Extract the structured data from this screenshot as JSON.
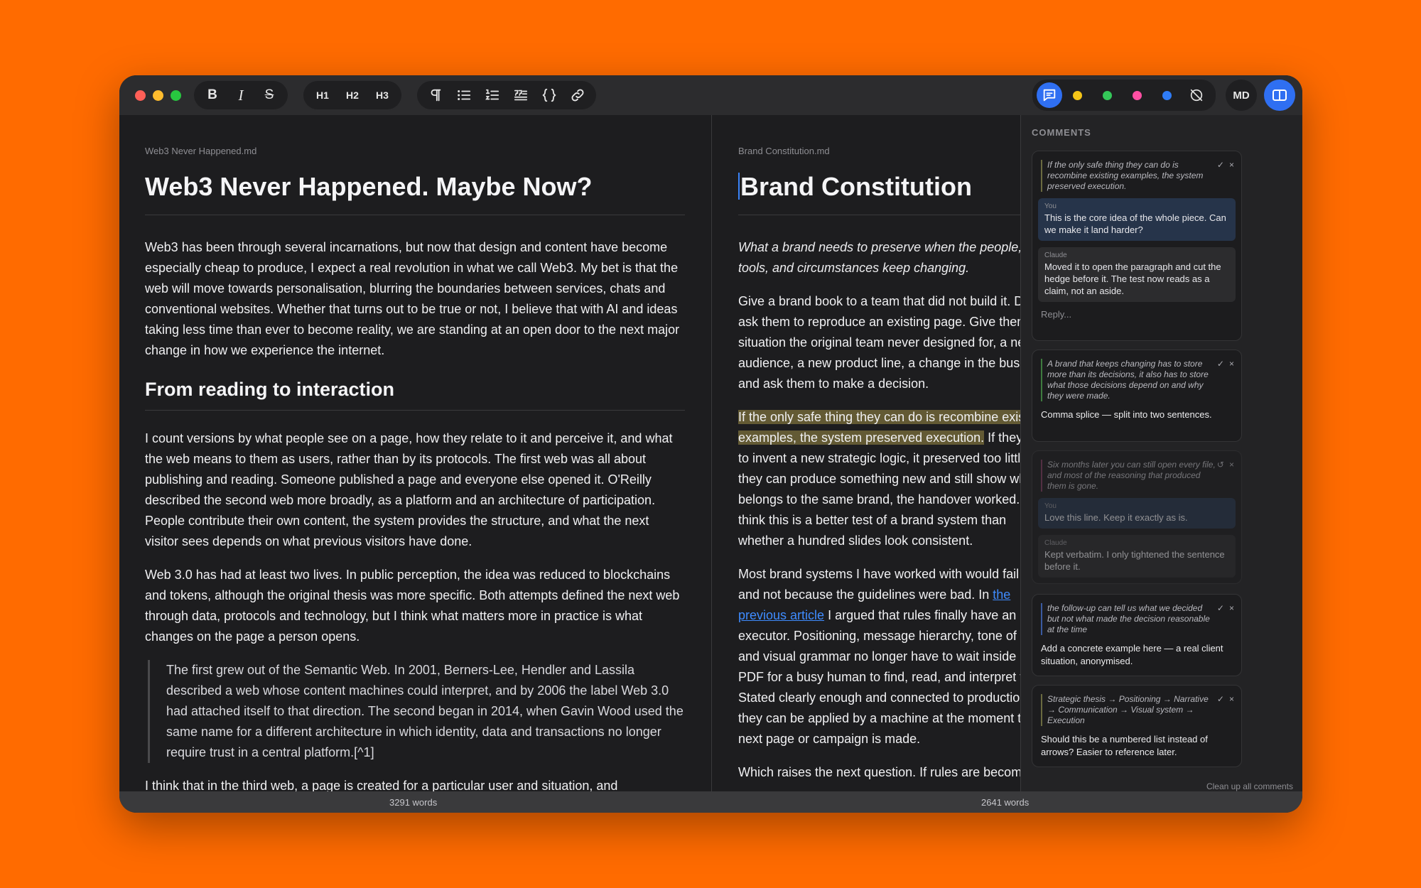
{
  "toolbar": {
    "format_buttons": {
      "bold": "B",
      "italic": "I",
      "strike": "S"
    },
    "headings": [
      "H1",
      "H2",
      "H3"
    ],
    "md_label": "MD"
  },
  "colors": {
    "yellow": "#f5c518",
    "green": "#34c759",
    "pink": "#ff4fa3",
    "blue": "#2f7cf6",
    "accent": "#2f6ff2"
  },
  "left_doc": {
    "filename": "Web3 Never Happened.md",
    "title": "Web3 Never Happened. Maybe Now?",
    "p1": "Web3 has been through several incarnations, but now that design and content have become especially cheap to produce, I expect a real revolution in what we call Web3. My bet is that the web will move towards personalisation, blurring the boundaries between services, chats and conventional websites. Whether that turns out to be true or not, I believe that with AI and ideas taking less time than ever to become reality, we are standing at an open door to the next major change in how we experience the internet.",
    "h2": "From reading to interaction",
    "p2": "I count versions by what people see on a page, how they relate to it and perceive it, and what the web means to them as users, rather than by its protocols. The first web was all about publishing and reading. Someone published a page and everyone else opened it. O'Reilly described the second web more broadly, as a platform and an architecture of participation. People contribute their own content, the system provides the structure, and what the next visitor sees depends on what previous visitors have done.",
    "p3": "Web 3.0 has had at least two lives. In public perception, the idea was reduced to blockchains and tokens, although the original thesis was more specific. Both attempts defined the next web through data, protocols and technology, but I think what matters more in practice is what changes on the page a person opens.",
    "quote": "The first grew out of the Semantic Web. In 2001, Berners-Lee, Hendler and Lassila described a web whose content machines could interpret, and by 2006 the label Web 3.0 had attached itself to that direction. The second began in 2014, when Gavin Wood used the same name for a different architecture in which identity, data and transactions no longer require trust in a central platform.[^1]",
    "p4": "I think that in the third web, a page is created for a particular user and situation, and",
    "word_count": "3291 words"
  },
  "right_doc": {
    "filename": "Brand Constitution.md",
    "title": "Brand Constitution",
    "lead": "What a brand needs to preserve when the people, tools, and circumstances keep changing.",
    "p1": "Give a brand book to a team that did not build it. Do not ask them to reproduce an existing page. Give them a situation the original team never designed for, a new audience, a new product line, a change in the business, and ask them to make a decision.",
    "p2_highlight": "If the only safe thing they can do is recombine existing examples, the system preserved execution.",
    "p2_rest": " If they have to invent a new strategic logic, it preserved too little. If they can produce something new and still show why it belongs to the same brand, the handover worked. I think this is a better test of a brand system than whether a hundred slides look consistent.",
    "p3_start": "Most brand systems I have worked with would fail it, and not because the guidelines were bad. In ",
    "p3_link": "the previous article",
    "p3_end": " I argued that rules finally have an executor. Positioning, message hierarchy, tone of voice, and visual grammar no longer have to wait inside a PDF for a busy human to find, read, and interpret them. Stated clearly enough and connected to production, they can be applied by a machine at the moment the next page or campaign is made.",
    "p4": "Which raises the next question. If rules are becoming",
    "word_count": "2641 words"
  },
  "comments": {
    "title": "COMMENTS",
    "cleanup": "Clean up all comments",
    "reply_placeholder": "Reply...",
    "items": [
      {
        "quote": "If the only safe thing they can do is recombine existing examples, the system preserved execution.",
        "you_label": "You",
        "you_text": "This is the core idea of the whole piece. Can we make it land harder?",
        "claude_label": "Claude",
        "claude_text": "Moved it to open the paragraph and cut the hedge before it. The test now reads as a claim, not an aside."
      },
      {
        "quote": "A brand that keeps changing has to store more than its decisions, it also has to store what those decisions depend on and why they were made.",
        "note": "Comma splice — split into two sentences."
      },
      {
        "quote": "Six months later you can still open every file, and most of the reasoning that produced them is gone.",
        "you_label": "You",
        "you_text": "Love this line. Keep it exactly as is.",
        "claude_label": "Claude",
        "claude_text": "Kept verbatim. I only tightened the sentence before it."
      },
      {
        "quote": "the follow-up can tell us what we decided but not what made the decision reasonable at the time",
        "note": "Add a concrete example here — a real client situation, anonymised."
      },
      {
        "quote": "Strategic thesis → Positioning → Narrative → Communication → Visual system → Execution",
        "note": "Should this be a numbered list instead of arrows? Easier to reference later."
      }
    ],
    "accept_icon": "✓",
    "dismiss_icon": "×",
    "restore_icon": "↺"
  }
}
